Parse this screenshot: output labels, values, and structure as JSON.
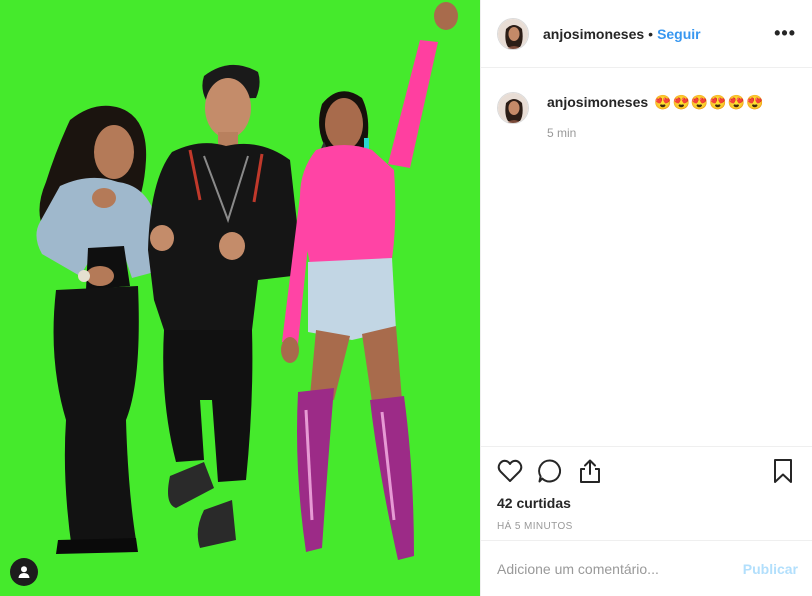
{
  "colors": {
    "background": "#45ea2c",
    "link_blue": "#3897f0",
    "publish_disabled": "#b2dffc",
    "muted_text": "#999999"
  },
  "media": {
    "tag_icon": "person-icon"
  },
  "header": {
    "username": "anjosimoneses",
    "separator": "•",
    "follow_label": "Seguir",
    "more_icon": "more-options-icon",
    "more_label": "•••"
  },
  "caption": {
    "username": "anjosimoneses",
    "text": "😍😍😍😍😍😍",
    "time": "5 min"
  },
  "actions": {
    "like_icon": "heart-icon",
    "comment_icon": "comment-icon",
    "share_icon": "share-icon",
    "save_icon": "bookmark-icon"
  },
  "likes": "42 curtidas",
  "posted_ago": "HÁ 5 MINUTOS",
  "add_comment": {
    "placeholder": "Adicione um comentário...",
    "publish_label": "Publicar"
  }
}
